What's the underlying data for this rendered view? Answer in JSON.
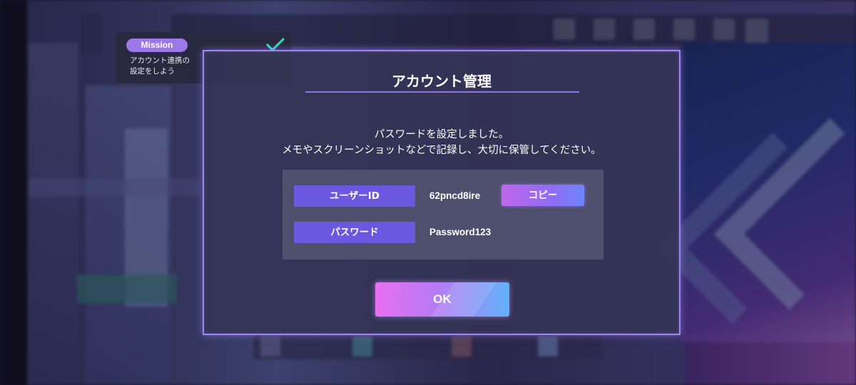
{
  "mission": {
    "badge": "Mission",
    "line1": "アカウント連携の",
    "line2": "設定をしよう"
  },
  "dialog": {
    "title": "アカウント管理",
    "message_line1": "パスワードを設定しました。",
    "message_line2": "メモやスクリーンショットなどで記録し、大切に保管してください。",
    "user_id_label": "ユーザーID",
    "user_id_value": "62pncd8ire",
    "copy_label": "コピー",
    "password_label": "パスワード",
    "password_value": "Password123",
    "ok_label": "OK"
  },
  "colors": {
    "accent": "#9f86f4",
    "label_bg": "#6b57e0",
    "check": "#2fd8b8"
  }
}
